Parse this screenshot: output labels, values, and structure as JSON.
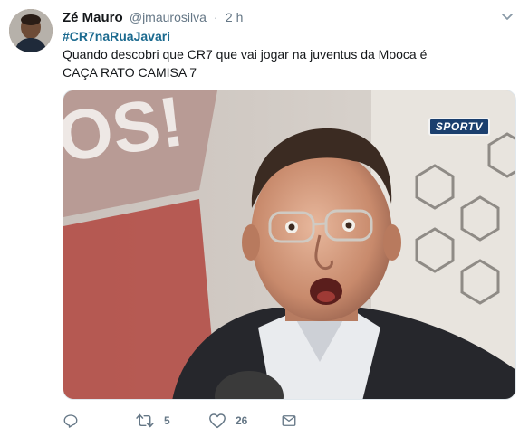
{
  "tweet": {
    "author": {
      "display_name": "Zé Mauro",
      "handle": "@jmaurosilva",
      "separator": "·",
      "time": "2 h"
    },
    "text": {
      "hashtag": "#CR7naRuaJavari",
      "line1": "Quando descobri que CR7 que vai jogar na juventus da Mooca é",
      "line2": "CAÇA RATO CAMISA 7"
    },
    "media": {
      "logo_text": "SPORTV"
    },
    "actions": {
      "reply_count": "",
      "retweet_count": "5",
      "like_count": "26"
    }
  },
  "colors": {
    "accent": "#1b6a8f",
    "muted": "#657786",
    "text": "#14171a"
  },
  "icons": [
    "reply-icon",
    "retweet-icon",
    "like-icon",
    "message-icon",
    "chevron-down-icon"
  ]
}
